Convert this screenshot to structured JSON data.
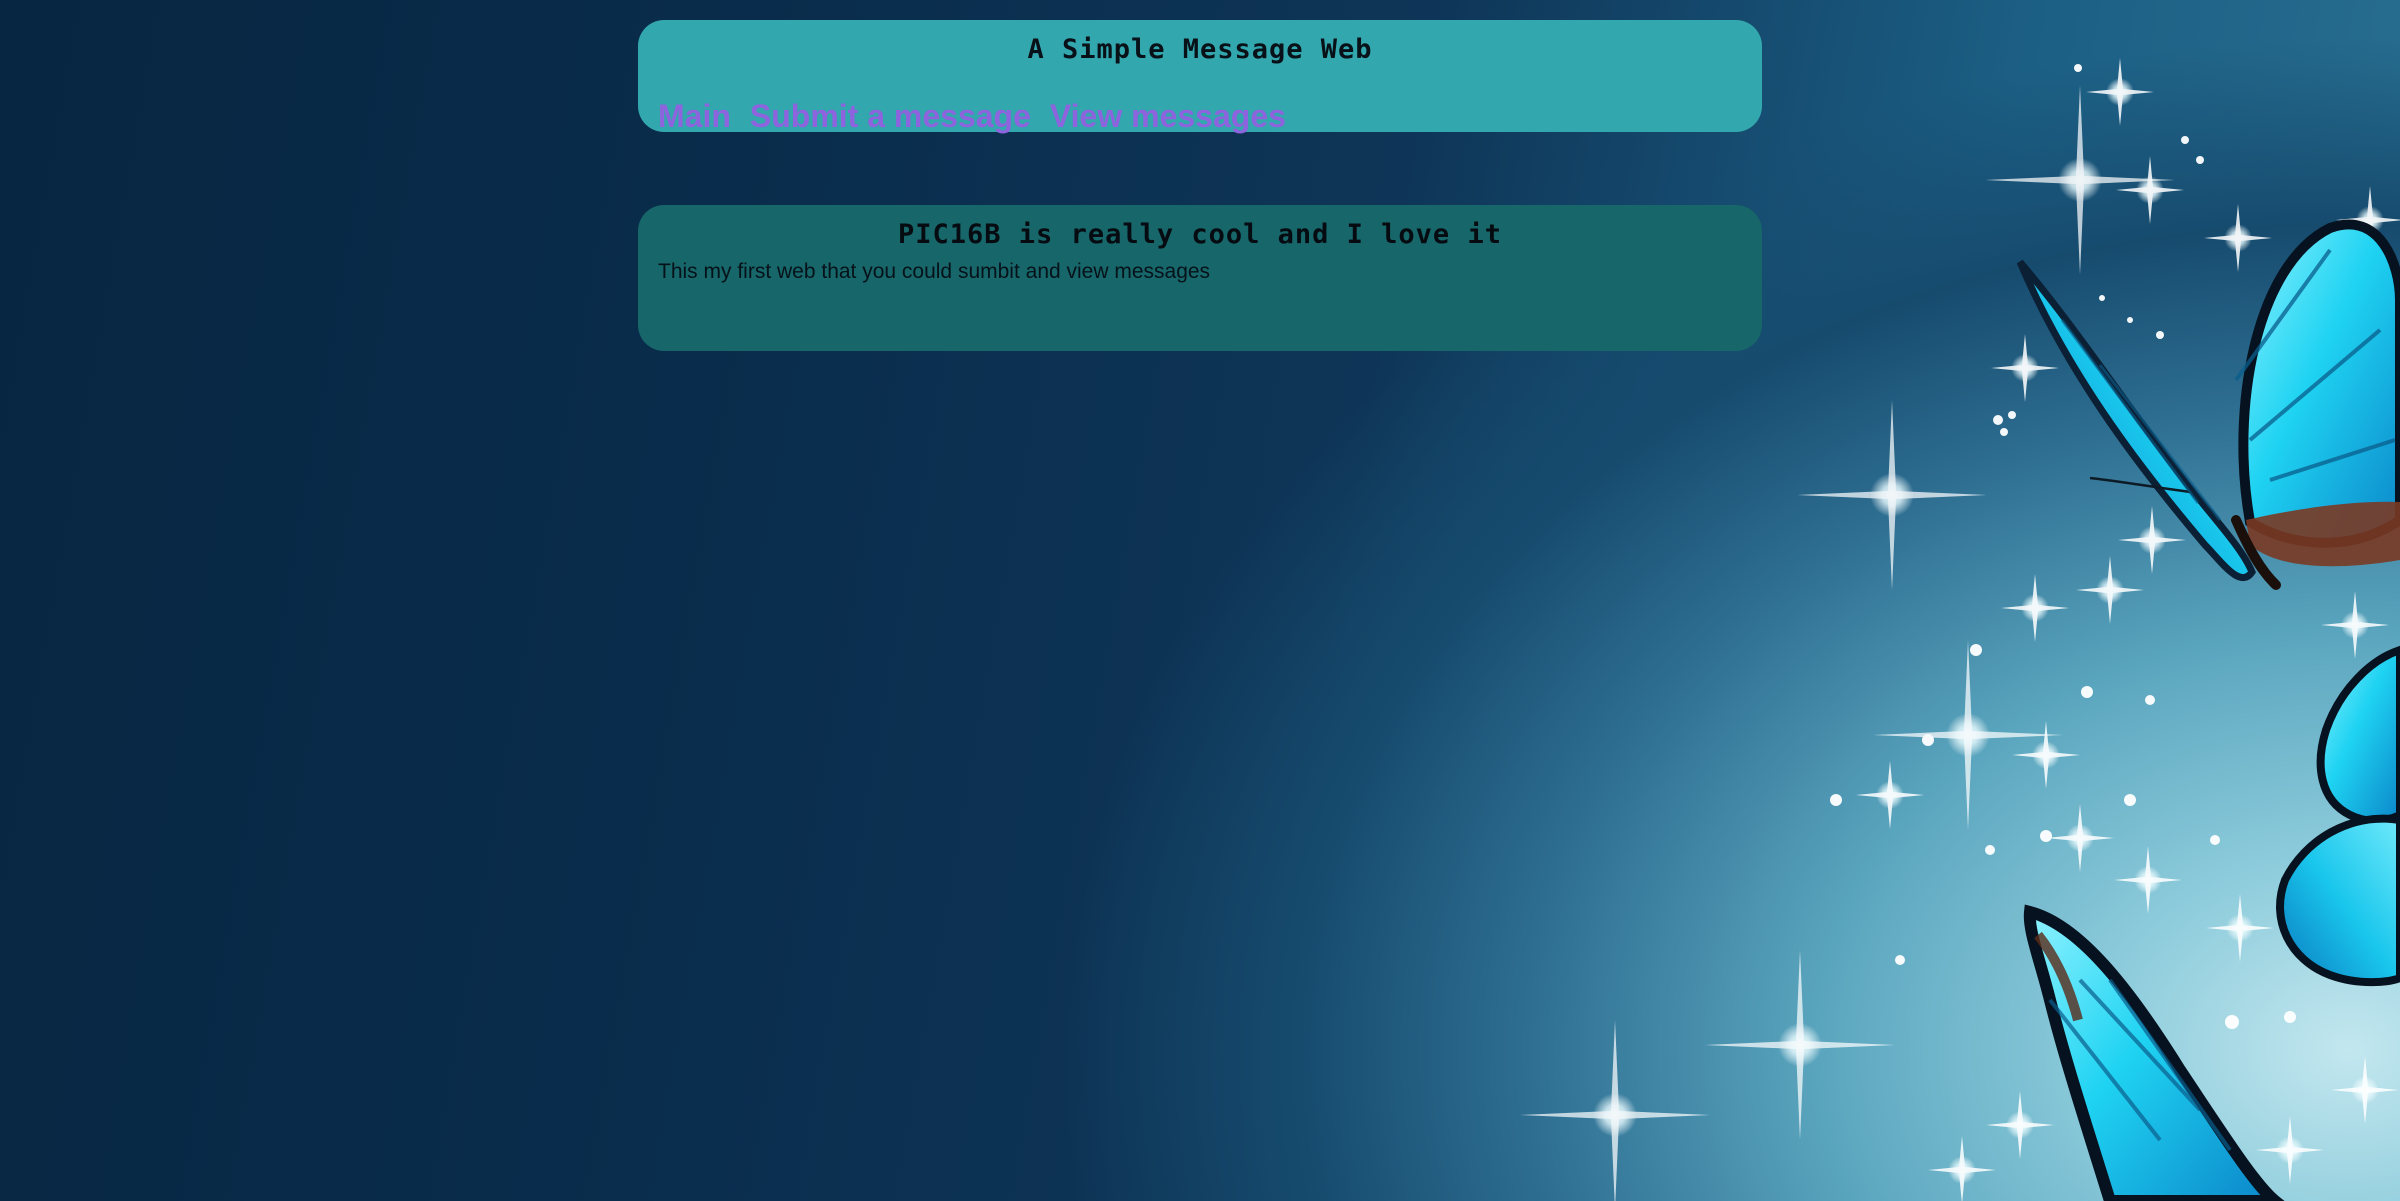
{
  "header": {
    "title": "A Simple Message Web",
    "nav": {
      "main": "Main",
      "submit": "Submit a message",
      "view": "View messages"
    }
  },
  "message": {
    "title": "PIC16B is really cool and I love it",
    "body": "This my first web that you could sumbit and view messages"
  },
  "colors": {
    "header_panel": "#33a7ae",
    "message_panel": "#176669",
    "nav_link": "#8d63de",
    "background_dark": "#072641",
    "butterfly": "#1fd3f2"
  },
  "decorations": {
    "background_image": "blue butterflies with sparkles",
    "icons": [
      "butterfly-icon",
      "sparkle-icon"
    ]
  }
}
